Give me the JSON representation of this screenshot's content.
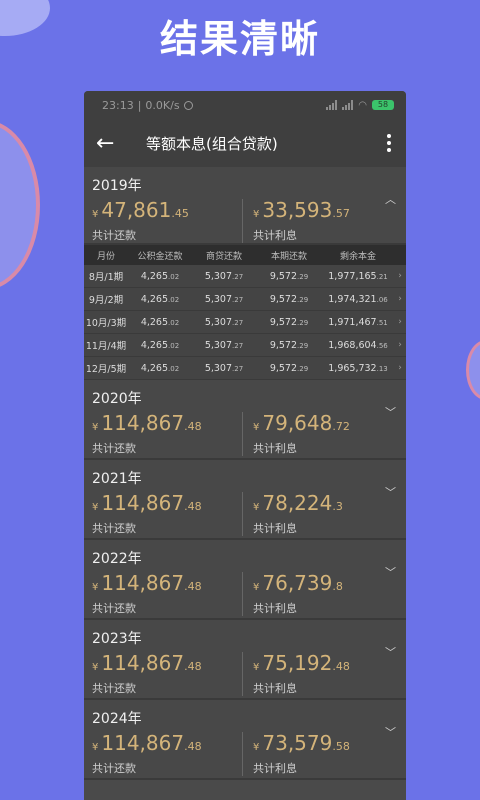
{
  "headline": "结果清晰",
  "status": {
    "time": "23:13",
    "speed": "0.0K/s",
    "battery": "58"
  },
  "toolbar": {
    "title": "等额本息(组合贷款)"
  },
  "table": {
    "headers": [
      "月份",
      "公积金还款",
      "商贷还款",
      "本期还款",
      "剩余本金"
    ],
    "rows": [
      {
        "month": "8月/1期",
        "gjj": "4,265",
        "gjj_dec": ".02",
        "sd": "5,307",
        "sd_dec": ".27",
        "bq": "9,572",
        "bq_dec": ".29",
        "sy": "1,977,165",
        "sy_dec": ".21"
      },
      {
        "month": "9月/2期",
        "gjj": "4,265",
        "gjj_dec": ".02",
        "sd": "5,307",
        "sd_dec": ".27",
        "bq": "9,572",
        "bq_dec": ".29",
        "sy": "1,974,321",
        "sy_dec": ".06"
      },
      {
        "month": "10月/3期",
        "gjj": "4,265",
        "gjj_dec": ".02",
        "sd": "5,307",
        "sd_dec": ".27",
        "bq": "9,572",
        "bq_dec": ".29",
        "sy": "1,971,467",
        "sy_dec": ".51"
      },
      {
        "month": "11月/4期",
        "gjj": "4,265",
        "gjj_dec": ".02",
        "sd": "5,307",
        "sd_dec": ".27",
        "bq": "9,572",
        "bq_dec": ".29",
        "sy": "1,968,604",
        "sy_dec": ".56"
      },
      {
        "month": "12月/5期",
        "gjj": "4,265",
        "gjj_dec": ".02",
        "sd": "5,307",
        "sd_dec": ".27",
        "bq": "9,572",
        "bq_dec": ".29",
        "sy": "1,965,732",
        "sy_dec": ".13"
      }
    ]
  },
  "years": [
    {
      "year": "2019年",
      "total_int": "47,861",
      "total_dec": ".45",
      "total_label": "共计还款",
      "interest_int": "33,593",
      "interest_dec": ".57",
      "interest_label": "共计利息",
      "expanded": true
    },
    {
      "year": "2020年",
      "total_int": "114,867",
      "total_dec": ".48",
      "total_label": "共计还款",
      "interest_int": "79,648",
      "interest_dec": ".72",
      "interest_label": "共计利息"
    },
    {
      "year": "2021年",
      "total_int": "114,867",
      "total_dec": ".48",
      "total_label": "共计还款",
      "interest_int": "78,224",
      "interest_dec": ".3",
      "interest_label": "共计利息"
    },
    {
      "year": "2022年",
      "total_int": "114,867",
      "total_dec": ".48",
      "total_label": "共计还款",
      "interest_int": "76,739",
      "interest_dec": ".8",
      "interest_label": "共计利息"
    },
    {
      "year": "2023年",
      "total_int": "114,867",
      "total_dec": ".48",
      "total_label": "共计还款",
      "interest_int": "75,192",
      "interest_dec": ".48",
      "interest_label": "共计利息"
    },
    {
      "year": "2024年",
      "total_int": "114,867",
      "total_dec": ".48",
      "total_label": "共计还款",
      "interest_int": "73,579",
      "interest_dec": ".58",
      "interest_label": "共计利息"
    }
  ],
  "currency": "¥",
  "icons": {
    "back": "arrow-left-icon",
    "more": "more-vert-icon",
    "expand": "chevron-down-icon",
    "collapse": "chevron-up-icon",
    "row": "chevron-right-icon"
  },
  "colors": {
    "background": "#6b72e8",
    "amount": "#d4b47a",
    "card": "#484848"
  }
}
